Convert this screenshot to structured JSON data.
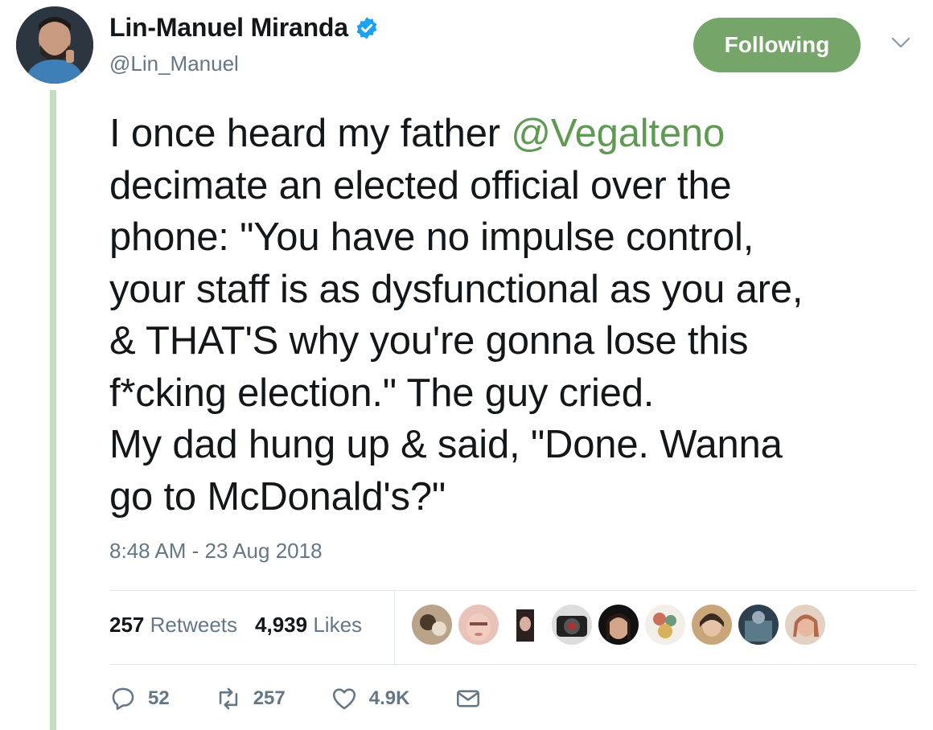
{
  "author": {
    "display_name": "Lin-Manuel Miranda",
    "handle": "@Lin_Manuel",
    "verified": true
  },
  "follow_button": {
    "label": "Following",
    "color": "#76a56a"
  },
  "tweet": {
    "lines": [
      {
        "before": "I once heard my father ",
        "mention": "@Vegalteno"
      },
      {
        "text": "decimate an elected official over the"
      },
      {
        "text": "phone: \"You have no impulse control,"
      },
      {
        "text": "your staff is as dysfunctional as you are,"
      },
      {
        "text": "& THAT'S why you're gonna lose this"
      },
      {
        "text": "f*cking election.\" The guy cried."
      },
      {
        "text": "My dad hung up & said, \"Done. Wanna"
      },
      {
        "text": "go to McDonald's?\""
      }
    ],
    "timestamp": "8:48 AM - 23 Aug 2018"
  },
  "stats": {
    "retweets_count": "257",
    "retweets_label": "Retweets",
    "likes_count": "4,939",
    "likes_label": "Likes"
  },
  "liker_avatars_count": 9,
  "actions": {
    "reply_count": "52",
    "retweet_count": "257",
    "like_count": "4.9K"
  },
  "colors": {
    "text": "#14171a",
    "secondary": "#657786",
    "link": "#5f9a52",
    "verified": "#1da1f2",
    "thread_line": "#c6dcc0"
  },
  "icons": [
    "verified-badge-icon",
    "chevron-down-icon",
    "reply-icon",
    "retweet-icon",
    "like-icon",
    "direct-message-icon"
  ]
}
